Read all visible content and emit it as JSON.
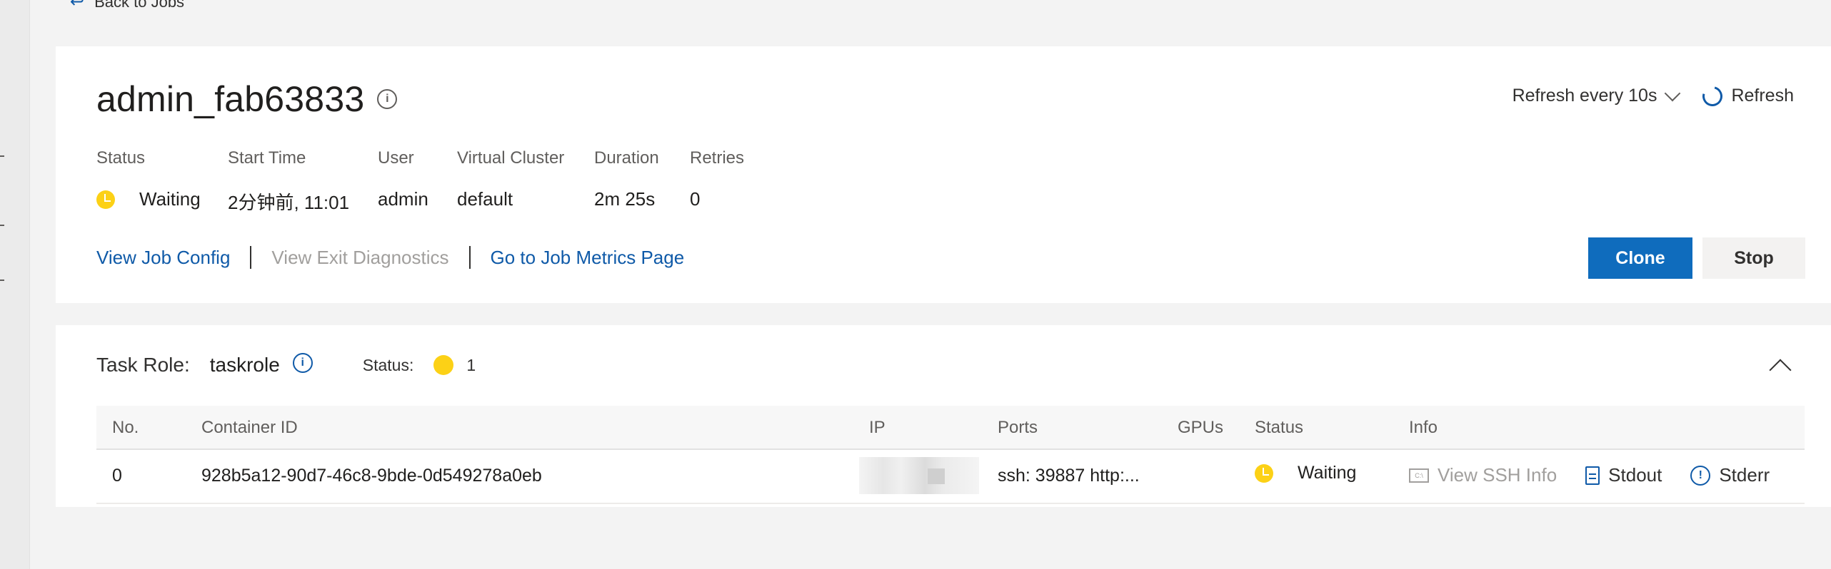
{
  "back": {
    "label": "Back to Jobs",
    "icon": "back-arrow-icon"
  },
  "job": {
    "title": "admin_fab63833",
    "refresh_every": "Refresh every 10s",
    "refresh_label": "Refresh",
    "meta": {
      "status": {
        "label": "Status",
        "value": "Waiting"
      },
      "start_time": {
        "label": "Start Time",
        "value": "2分钟前, 11:01"
      },
      "user": {
        "label": "User",
        "value": "admin"
      },
      "virtual_cluster": {
        "label": "Virtual Cluster",
        "value": "default"
      },
      "duration": {
        "label": "Duration",
        "value": "2m 25s"
      },
      "retries": {
        "label": "Retries",
        "value": "0"
      }
    },
    "links": {
      "view_config": "View Job Config",
      "view_exit_diagnostics": "View Exit Diagnostics",
      "job_metrics": "Go to Job Metrics Page"
    },
    "actions": {
      "clone": "Clone",
      "stop": "Stop"
    }
  },
  "task_role": {
    "label": "Task Role:",
    "name": "taskrole",
    "status_label": "Status:",
    "status_count": "1",
    "columns": {
      "no": "No.",
      "container_id": "Container ID",
      "ip": "IP",
      "ports": "Ports",
      "gpus": "GPUs",
      "status": "Status",
      "info": "Info"
    },
    "rows": [
      {
        "no": "0",
        "container_id": "928b5a12-90d7-46c8-9bde-0d549278a0eb",
        "ports": "ssh: 39887  http:...",
        "gpus": "",
        "status": "Waiting",
        "info": {
          "ssh": "View SSH Info",
          "stdout": "Stdout",
          "stderr": "Stderr"
        }
      }
    ]
  },
  "colors": {
    "accent": "#0f6cbd",
    "link": "#0f5aa8",
    "waiting": "#fcd116",
    "disabled": "#a19f9d"
  }
}
